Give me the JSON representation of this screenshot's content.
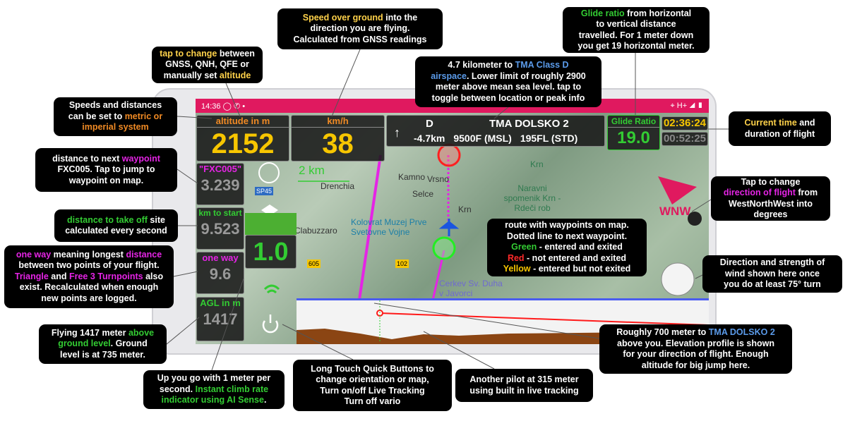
{
  "colors": {
    "status_bar": "#e0195f",
    "yellow": "#f7c600",
    "orange": "#f08a24",
    "green": "#33cc33",
    "magenta": "#e524e5",
    "blue": "#5b9bea",
    "red": "#ff2a2a",
    "hl_yellow": "#ffd24a"
  },
  "status": {
    "time": "14:36",
    "icons": [
      "whatsapp-icon",
      "phone-icon",
      "dot-icon",
      "location-icon",
      "signal-icon",
      "battery-icon"
    ],
    "right_text": "H+"
  },
  "altitude": {
    "label": "altitude in m",
    "value": "2152"
  },
  "speed": {
    "label": "km/h",
    "value": "38"
  },
  "airspace": {
    "class": "D",
    "name": "TMA DOLSKO 2",
    "arrow": "↑",
    "distance": "-4.7km",
    "msl": "9500F (MSL)",
    "std": "195FL (STD)"
  },
  "glide": {
    "label": "Glide Ratio",
    "value": "19.0"
  },
  "clock": {
    "current": "02:36:24",
    "duration": "00:52:25"
  },
  "left": [
    {
      "label": "\"FXC005\"",
      "value": "3.239",
      "color": "#e524e5"
    },
    {
      "label": "km to start",
      "value": "9.523",
      "color": "#33cc33"
    },
    {
      "label": "one way",
      "value": "9.6",
      "color": "#e524e5"
    },
    {
      "label": "AGL in m",
      "value": "1417",
      "color": "#33cc33"
    }
  ],
  "vario": {
    "value": "1.0"
  },
  "map": {
    "scale": "2 km",
    "labels": [
      "Kamno",
      "Vrsno",
      "Selce",
      "Drenchia",
      "Krn",
      "Krn",
      "Naravni spomenik Krn - Rdeči rob",
      "Kolovrat Muzej Prve Svetovne Vojne",
      "Clabuzzaro",
      "Cerkev Sv. Duha v Javorci"
    ],
    "roads": [
      "SP45",
      "605",
      "102"
    ],
    "wind_dir": "WNW"
  },
  "callouts": [
    [
      [
        {
          "t": "tap to change",
          "c": "hl_yellow"
        },
        {
          "t": " between"
        }
      ],
      [
        {
          "t": "GNSS, QNH, QFE or"
        }
      ],
      [
        {
          "t": "manually set "
        },
        {
          "t": "altitude",
          "c": "hl_yellow"
        }
      ]
    ],
    [
      [
        {
          "t": "Speed over ground",
          "c": "hl_yellow"
        },
        {
          "t": " into the"
        }
      ],
      [
        {
          "t": "direction you are flying."
        }
      ],
      [
        {
          "t": "Calculated from GNSS readings"
        }
      ]
    ],
    [
      [
        {
          "t": "4.7 kilometer to "
        },
        {
          "t": "TMA Class D",
          "c": "blue"
        }
      ],
      [
        {
          "t": "airspace",
          "c": "blue"
        },
        {
          "t": ". Lower limit of roughly 2900"
        }
      ],
      [
        {
          "t": "meter above mean sea level. tap to"
        }
      ],
      [
        {
          "t": "toggle between location or peak info"
        }
      ]
    ],
    [
      [
        {
          "t": "Glide ratio",
          "c": "green"
        },
        {
          "t": " from horizontal"
        }
      ],
      [
        {
          "t": "to vertical distance"
        }
      ],
      [
        {
          "t": "travelled. For 1 meter down"
        }
      ],
      [
        {
          "t": "you get 19 horizontal meter."
        }
      ]
    ],
    [
      [
        {
          "t": "Speeds and distances"
        }
      ],
      [
        {
          "t": "can be set to "
        },
        {
          "t": "metric or",
          "c": "orange"
        }
      ],
      [
        {
          "t": "imperial system",
          "c": "orange"
        }
      ]
    ],
    [
      [
        {
          "t": "Current time",
          "c": "hl_yellow"
        },
        {
          "t": " and"
        }
      ],
      [
        {
          "t": "duration of flight"
        }
      ]
    ],
    [
      [
        {
          "t": "distance to next "
        },
        {
          "t": "waypoint",
          "c": "magenta"
        }
      ],
      [
        {
          "t": "FXC005. Tap to jump to"
        }
      ],
      [
        {
          "t": "waypoint on map."
        }
      ]
    ],
    [
      [
        {
          "t": "Tap to change"
        }
      ],
      [
        {
          "t": "direction of flight",
          "c": "magenta"
        },
        {
          "t": " from"
        }
      ],
      [
        {
          "t": "WestNorthWest into"
        }
      ],
      [
        {
          "t": "degrees"
        }
      ]
    ],
    [
      [
        {
          "t": "distance to take off",
          "c": "green"
        },
        {
          "t": " site"
        }
      ],
      [
        {
          "t": "calculated every second"
        }
      ]
    ],
    [
      [
        {
          "t": "one way",
          "c": "magenta"
        },
        {
          "t": " meaning longest "
        },
        {
          "t": "distance",
          "c": "magenta"
        }
      ],
      [
        {
          "t": "between two points  of your flight."
        }
      ],
      [
        {
          "t": "Triangle",
          "c": "magenta"
        },
        {
          "t": " and "
        },
        {
          "t": "Free 3 Turnpoints",
          "c": "magenta"
        },
        {
          "t": " also"
        }
      ],
      [
        {
          "t": "exist. Recalculated when enough"
        }
      ],
      [
        {
          "t": "new points are logged."
        }
      ]
    ],
    [
      [
        {
          "t": "route with waypoints on map."
        }
      ],
      [
        {
          "t": "Dotted line to next waypoint."
        }
      ],
      [
        {
          "t": "Green",
          "c": "green"
        },
        {
          "t": " - entered and exited"
        }
      ],
      [
        {
          "t": "Red",
          "c": "red"
        },
        {
          "t": " - not entered and exited"
        }
      ],
      [
        {
          "t": "Yellow",
          "c": "yellow"
        },
        {
          "t": " - entered but not exited"
        }
      ]
    ],
    [
      [
        {
          "t": "Direction and strength of"
        }
      ],
      [
        {
          "t": "wind shown here once"
        }
      ],
      [
        {
          "t": "you do at least 75° turn"
        }
      ]
    ],
    [
      [
        {
          "t": "Flying 1417 meter "
        },
        {
          "t": "above",
          "c": "green"
        }
      ],
      [
        {
          "t": "ground level",
          "c": "green"
        },
        {
          "t": ". Ground"
        }
      ],
      [
        {
          "t": "level is at 735 meter."
        }
      ]
    ],
    [
      [
        {
          "t": "Up you go with 1 meter per"
        }
      ],
      [
        {
          "t": "second. "
        },
        {
          "t": "Instant climb rate",
          "c": "green"
        }
      ],
      [
        {
          "t": "indicator using AI Sense",
          "c": "green"
        },
        {
          "t": "."
        }
      ]
    ],
    [
      [
        {
          "t": "Long Touch Quick Buttons to"
        }
      ],
      [
        {
          "t": "change orientation or map,"
        }
      ],
      [
        {
          "t": "Turn on/off Live Tracking"
        }
      ],
      [
        {
          "t": "Turn off vario"
        }
      ]
    ],
    [
      [
        {
          "t": "Another pilot at 315 meter"
        }
      ],
      [
        {
          "t": "using built in live tracking"
        }
      ]
    ],
    [
      [
        {
          "t": "Roughly 700 meter to "
        },
        {
          "t": "TMA DOLSKO 2",
          "c": "blue"
        }
      ],
      [
        {
          "t": "above you. Elevation profile is shown"
        }
      ],
      [
        {
          "t": "for your direction of flight. Enough"
        }
      ],
      [
        {
          "t": "altitude for big jump here."
        }
      ]
    ]
  ]
}
